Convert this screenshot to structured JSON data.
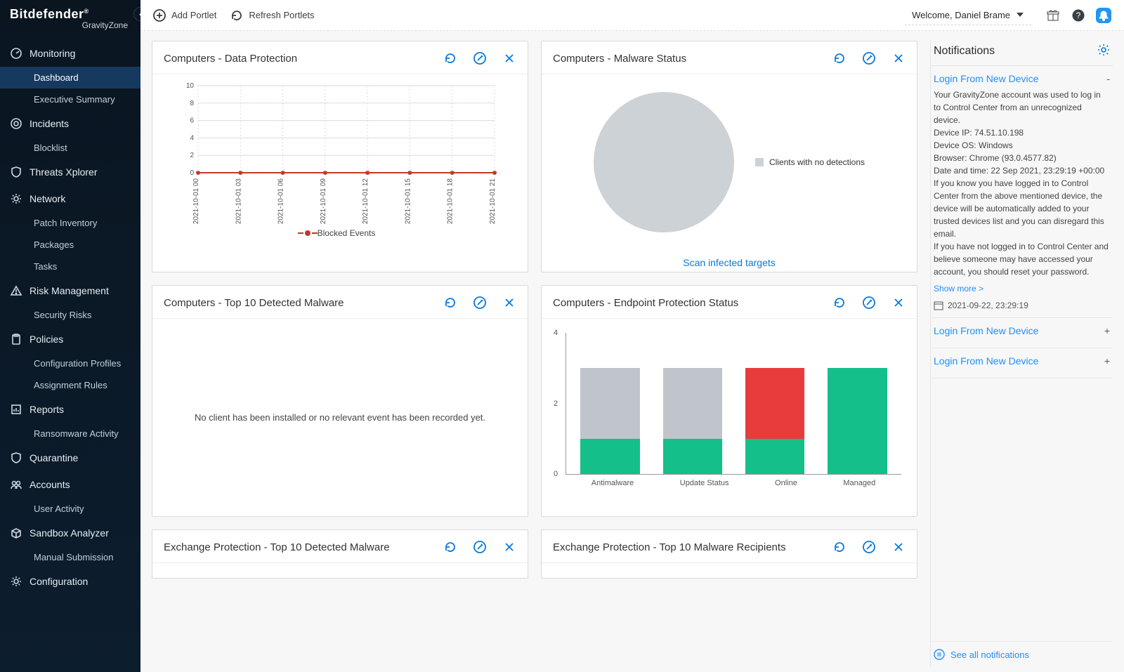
{
  "brand": {
    "name": "Bitdefender",
    "suffix": "®",
    "sub": "GravityZone"
  },
  "topbar": {
    "add_portlet": "Add Portlet",
    "refresh_portlets": "Refresh Portlets",
    "welcome": "Welcome, Daniel Brame"
  },
  "sidebar": [
    {
      "type": "section",
      "icon": "gauge",
      "label": "Monitoring",
      "children": [
        {
          "label": "Dashboard",
          "active": true
        },
        {
          "label": "Executive Summary"
        }
      ]
    },
    {
      "type": "section",
      "icon": "target",
      "label": "Incidents",
      "children": [
        {
          "label": "Blocklist"
        }
      ]
    },
    {
      "type": "section",
      "icon": "shield",
      "label": "Threats Xplorer",
      "children": []
    },
    {
      "type": "section",
      "icon": "gear",
      "label": "Network",
      "children": [
        {
          "label": "Patch Inventory"
        },
        {
          "label": "Packages"
        },
        {
          "label": "Tasks"
        }
      ]
    },
    {
      "type": "section",
      "icon": "warning",
      "label": "Risk Management",
      "children": [
        {
          "label": "Security Risks"
        }
      ]
    },
    {
      "type": "section",
      "icon": "clipboard",
      "label": "Policies",
      "children": [
        {
          "label": "Configuration Profiles"
        },
        {
          "label": "Assignment Rules"
        }
      ]
    },
    {
      "type": "section",
      "icon": "report",
      "label": "Reports",
      "children": [
        {
          "label": "Ransomware Activity"
        }
      ]
    },
    {
      "type": "section",
      "icon": "shield",
      "label": "Quarantine",
      "children": []
    },
    {
      "type": "section",
      "icon": "users",
      "label": "Accounts",
      "children": [
        {
          "label": "User Activity"
        }
      ]
    },
    {
      "type": "section",
      "icon": "box",
      "label": "Sandbox Analyzer",
      "children": [
        {
          "label": "Manual Submission"
        }
      ]
    },
    {
      "type": "section",
      "icon": "gear",
      "label": "Configuration",
      "children": []
    }
  ],
  "portlets": {
    "dp": {
      "title": "Computers - Data Protection",
      "legend": "Blocked Events"
    },
    "malware_status": {
      "title": "Computers - Malware Status",
      "legend": "Clients with no detections",
      "footer_link": "Scan infected targets"
    },
    "top10_malware": {
      "title": "Computers - Top 10 Detected Malware",
      "empty": "No client has been installed or no relevant event has been recorded yet."
    },
    "endpoint": {
      "title": "Computers - Endpoint Protection Status"
    },
    "exchange_malware": {
      "title": "Exchange Protection - Top 10 Detected Malware"
    },
    "exchange_recipients": {
      "title": "Exchange Protection - Top 10 Malware Recipients"
    }
  },
  "notifications": {
    "title": "Notifications",
    "items": [
      {
        "title": "Login From New Device",
        "expanded": true,
        "body": "Your GravityZone account was used to log in to Control Center from an unrecognized device.\nDevice IP: 74.51.10.198\nDevice OS: Windows\nBrowser: Chrome (93.0.4577.82)\nDate and time: 22 Sep 2021, 23:29:19 +00:00\nIf you know you have logged in to Control Center from the above mentioned device, the device will be automatically added to your trusted devices list and you can disregard this email.\nIf you have not logged in to Control Center and believe someone may have accessed your account, you should reset your password.",
        "more": "Show more >",
        "date": "2021-09-22, 23:29:19"
      },
      {
        "title": "Login From New Device",
        "expanded": false,
        "toggle": "+"
      },
      {
        "title": "Login From New Device",
        "expanded": false,
        "toggle": "+"
      }
    ],
    "see_all": "See all notifications"
  },
  "chart_data": [
    {
      "id": "data_protection",
      "type": "line",
      "title": "Computers - Data Protection",
      "series": [
        {
          "name": "Blocked Events",
          "values": [
            0,
            0,
            0,
            0,
            0,
            0,
            0,
            0
          ]
        }
      ],
      "categories": [
        "2021-10-01 00",
        "2021-10-01 03",
        "2021-10-01 06",
        "2021-10-01 09",
        "2021-10-01 12",
        "2021-10-01 15",
        "2021-10-01 18",
        "2021-10-01 21"
      ],
      "ylim": [
        0,
        10
      ],
      "yticks": [
        0,
        2,
        4,
        6,
        8,
        10
      ],
      "xlabel": "",
      "ylabel": ""
    },
    {
      "id": "malware_status",
      "type": "pie",
      "title": "Computers - Malware Status",
      "slices": [
        {
          "name": "Clients with no detections",
          "value": 100,
          "color": "#cdd2d6"
        }
      ]
    },
    {
      "id": "endpoint_protection",
      "type": "bar",
      "title": "Computers - Endpoint Protection Status",
      "stacked": true,
      "categories": [
        "Antimalware",
        "Update Status",
        "Online",
        "Managed"
      ],
      "series": [
        {
          "name": "green",
          "color": "#14bf8a",
          "values": [
            1,
            1,
            1,
            3
          ]
        },
        {
          "name": "red",
          "color": "#e83c3c",
          "values": [
            0,
            0,
            2,
            0
          ]
        },
        {
          "name": "grey",
          "color": "#bfc5ca",
          "values": [
            2,
            2,
            0,
            0
          ]
        }
      ],
      "ylim": [
        0,
        4
      ],
      "yticks": [
        0,
        2,
        4
      ]
    }
  ]
}
